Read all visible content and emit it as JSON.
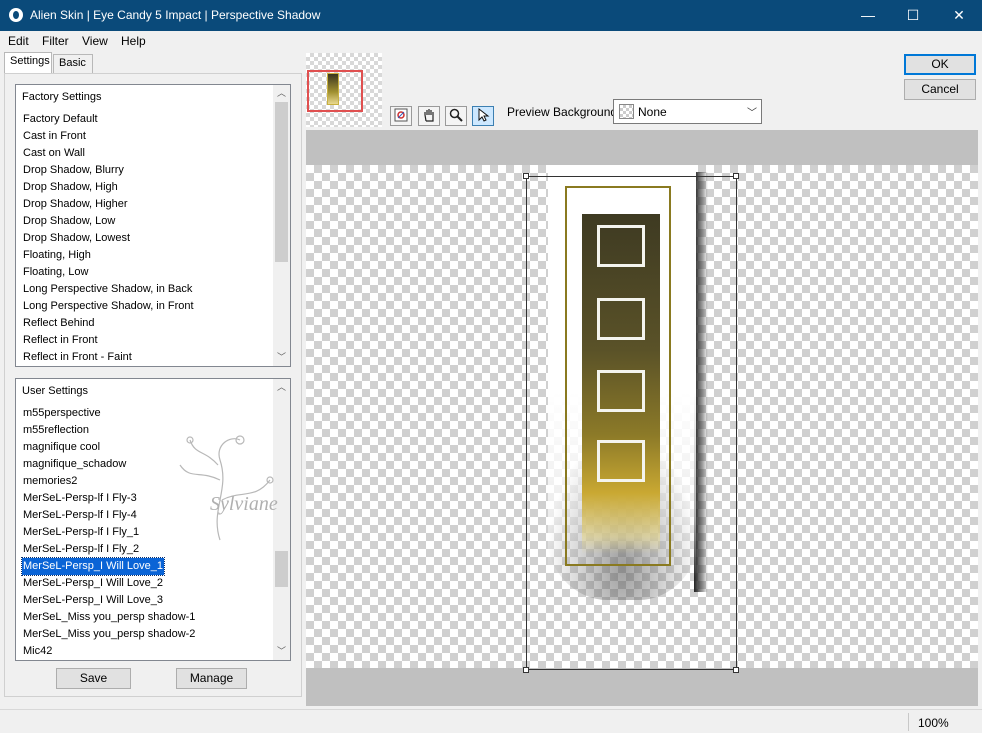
{
  "window": {
    "title": "Alien Skin | Eye Candy 5 Impact | Perspective Shadow",
    "minimize": "—",
    "maximize": "☐",
    "close": "✕"
  },
  "menu": {
    "edit": "Edit",
    "filter": "Filter",
    "view": "View",
    "help": "Help"
  },
  "tabs": {
    "settings": "Settings",
    "basic": "Basic"
  },
  "factory_settings": {
    "header": "Factory Settings",
    "items": [
      "Factory Default",
      "Cast in Front",
      "Cast on Wall",
      "Drop Shadow, Blurry",
      "Drop Shadow, High",
      "Drop Shadow, Higher",
      "Drop Shadow, Low",
      "Drop Shadow, Lowest",
      "Floating, High",
      "Floating, Low",
      "Long Perspective Shadow, in Back",
      "Long Perspective Shadow, in Front",
      "Reflect Behind",
      "Reflect in Front",
      "Reflect in Front - Faint"
    ]
  },
  "user_settings": {
    "header": "User Settings",
    "selected_index": 9,
    "items": [
      "m55perspective",
      "m55reflection",
      "magnifique cool",
      "magnifique_schadow",
      "memories2",
      "MerSeL-Persp-lf I Fly-3",
      "MerSeL-Persp-lf I Fly-4",
      "MerSeL-Persp-lf I Fly_1",
      "MerSeL-Persp-lf I Fly_2",
      "MerSeL-Persp_I Will Love_1",
      "MerSeL-Persp_I Will Love_2",
      "MerSeL-Persp_I Will Love_3",
      "MerSeL_Miss you_persp shadow-1",
      "MerSeL_Miss you_persp shadow-2",
      "Mic42"
    ]
  },
  "buttons": {
    "save": "Save",
    "manage": "Manage",
    "ok": "OK",
    "cancel": "Cancel"
  },
  "toolbar": {
    "tools": [
      "navigate-icon",
      "hand-icon",
      "zoom-icon",
      "select-arrow-icon"
    ],
    "active_tool": "select-arrow-icon"
  },
  "preview_background": {
    "label": "Preview Background:",
    "value": "None"
  },
  "watermark": {
    "text": "Sylviane"
  },
  "status": {
    "zoom": "100%"
  }
}
